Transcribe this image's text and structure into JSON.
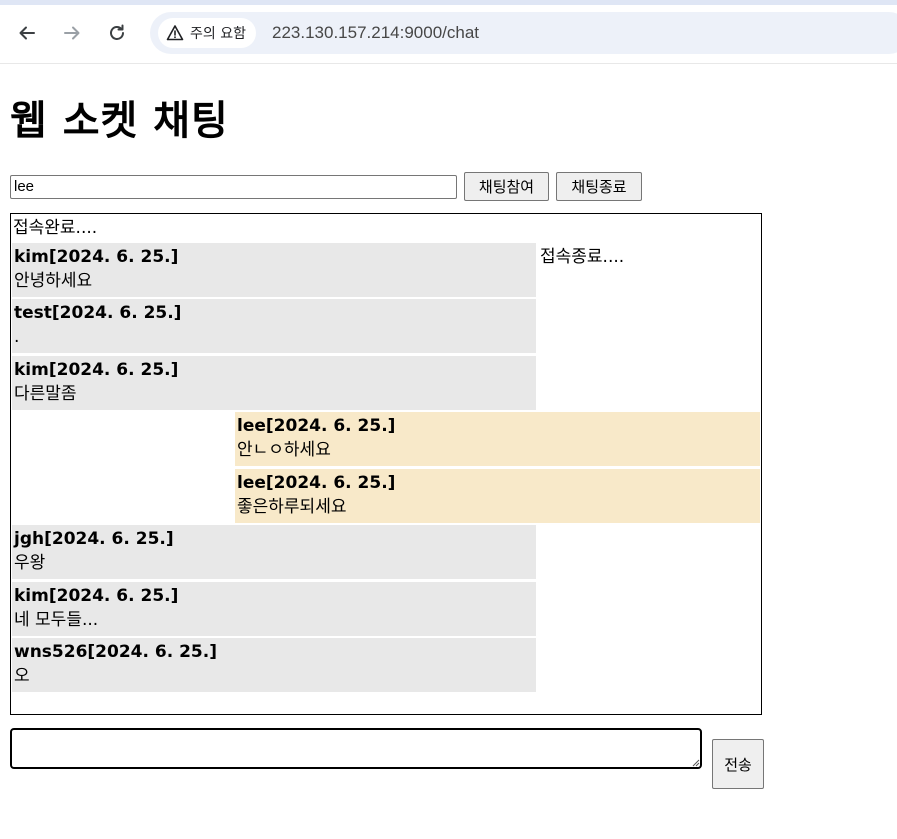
{
  "browser": {
    "security_label": "주의 요함",
    "url": "223.130.157.214:9000/chat"
  },
  "page": {
    "title": "웹 소켓 채팅"
  },
  "controls": {
    "name_value": "lee",
    "join_label": "채팅참여",
    "leave_label": "채팅종료",
    "send_label": "전송",
    "message_value": ""
  },
  "chat": {
    "status_connected": "접속완료....",
    "status_ended": "접속종료....",
    "messages": [
      {
        "sender": "kim[2024. 6. 25.]",
        "text": "안녕하세요",
        "mine": false
      },
      {
        "sender": "test[2024. 6. 25.]",
        "text": ".",
        "mine": false
      },
      {
        "sender": "kim[2024. 6. 25.]",
        "text": "다른말좀",
        "mine": false
      },
      {
        "sender": "lee[2024. 6. 25.]",
        "text": "안ㄴㅇ하세요",
        "mine": true
      },
      {
        "sender": "lee[2024. 6. 25.]",
        "text": "좋은하루되세요",
        "mine": true
      },
      {
        "sender": "jgh[2024. 6. 25.]",
        "text": "우왕",
        "mine": false
      },
      {
        "sender": "kim[2024. 6. 25.]",
        "text": "네 모두들...",
        "mine": false
      },
      {
        "sender": "wns526[2024. 6. 25.]",
        "text": "오",
        "mine": false
      }
    ]
  }
}
